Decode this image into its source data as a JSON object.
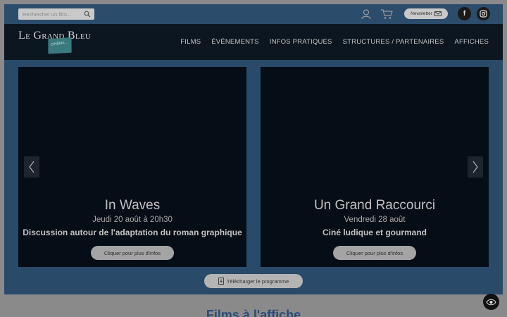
{
  "topbar": {
    "search_placeholder": "Rechercher un film...",
    "newsletter_label": "Newsletter"
  },
  "brand": {
    "name": "Le Grand Bleu",
    "tag": "CINÉMA ..."
  },
  "nav": {
    "items": [
      "FILMS",
      "ÉVÉNEMENTS",
      "INFOS PRATIQUES",
      "STRUCTURES / PARTENAIRES",
      "AFFICHES"
    ]
  },
  "slides": [
    {
      "title": "In Waves",
      "date": "Jeudi 20 août à 20h30",
      "description": "Discussion autour de l'adaptation du roman graphique",
      "button": "Cliquer pour plus d'infos"
    },
    {
      "title": "Un Grand Raccourci",
      "date": "Vendredi 28 août",
      "description": "Ciné ludique et gourmand",
      "button": "Cliquer pour plus d'infos"
    }
  ],
  "download_label": "Télécharger le programme",
  "section_heading": "Films à l'affiche",
  "icons": [
    "search-icon",
    "user-icon",
    "cart-icon",
    "mail-icon",
    "facebook-icon",
    "instagram-icon",
    "chevron-left-icon",
    "chevron-right-icon",
    "document-icon",
    "accessibility-eye-icon"
  ],
  "colors": {
    "topbar": "#2c4c6c",
    "navbar": "#0c1620",
    "card": "#050d16",
    "heading": "#2c4c78"
  }
}
